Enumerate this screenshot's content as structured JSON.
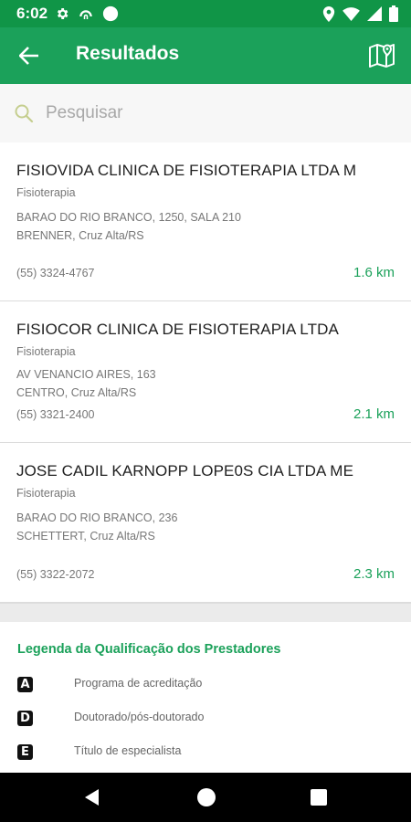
{
  "status_bar": {
    "time": "6:02",
    "icons": [
      "settings-gear-icon",
      "vpn-icon",
      "circle-icon",
      "location-icon",
      "wifi-icon",
      "signal-icon",
      "battery-icon"
    ]
  },
  "app_bar": {
    "title": "Resultados",
    "back_icon": "arrow-back-icon",
    "map_icon": "map-pin-icon",
    "background_color": "#1ba15a"
  },
  "search": {
    "placeholder": "Pesquisar",
    "value": ""
  },
  "results": [
    {
      "name": "FISIOVIDA CLINICA DE FISIOTERAPIA LTDA M",
      "category": "Fisioterapia",
      "address_line1": "BARAO DO RIO BRANCO, 1250, SALA 210",
      "address_line2": "BRENNER, Cruz Alta/RS",
      "phone": "(55) 3324-4767",
      "distance": "1.6 km"
    },
    {
      "name": "FISIOCOR CLINICA DE FISIOTERAPIA LTDA",
      "category": "Fisioterapia",
      "address_line1": "AV VENANCIO AIRES, 163",
      "address_line2": "CENTRO, Cruz Alta/RS",
      "phone": "(55) 3321-2400",
      "distance": "2.1 km"
    },
    {
      "name": "JOSE CADIL KARNOPP LOPE0S CIA LTDA ME",
      "category": "Fisioterapia",
      "address_line1": "BARAO DO RIO BRANCO, 236",
      "address_line2": "SCHETTERT, Cruz Alta/RS",
      "phone": "(55) 3322-2072",
      "distance": "2.3 km"
    }
  ],
  "legend": {
    "title": "Legenda da Qualificação dos Prestadores",
    "items": [
      {
        "badge": "A",
        "label": "Programa de acreditação"
      },
      {
        "badge": "D",
        "label": "Doutorado/pós-doutorado"
      },
      {
        "badge": "E",
        "label": "Título de especialista"
      }
    ]
  },
  "colors": {
    "accent": "#1ba15a",
    "status_bar": "#109547",
    "distance": "#1ba15a"
  }
}
